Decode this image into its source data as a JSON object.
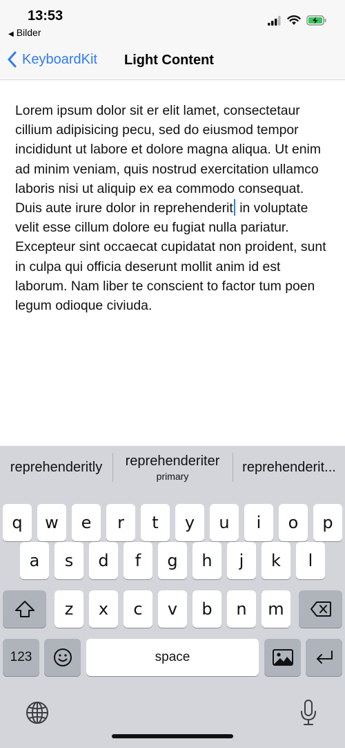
{
  "status_bar": {
    "time": "13:53",
    "back_app": "Bilder",
    "icons": [
      "cellular-signal-icon",
      "wifi-icon",
      "battery-charging-icon"
    ]
  },
  "nav": {
    "back_label": "KeyboardKit",
    "title": "Light Content"
  },
  "content": {
    "text_before_cursor": "Lorem ipsum dolor sit er elit lamet, consectetaur cillium adipisicing pecu, sed do eiusmod tempor incididunt ut labore et dolore magna aliqua. Ut enim ad minim veniam, quis nostrud exercitation ullamco laboris nisi ut aliquip ex ea commodo consequat. Duis aute irure dolor in reprehenderit",
    "text_after_cursor": " in voluptate velit esse cillum dolore eu fugiat nulla pariatur. Excepteur sint occaecat cupidatat non proident, sunt in culpa qui officia deserunt mollit anim id est laborum. Nam liber te conscient to factor tum poen legum odioque civiuda."
  },
  "keyboard": {
    "suggestions": [
      {
        "label": "reprehenderitly",
        "sub": ""
      },
      {
        "label": "reprehenderiter",
        "sub": "primary"
      },
      {
        "label": "reprehenderit..."
      }
    ],
    "row1": [
      "q",
      "w",
      "e",
      "r",
      "t",
      "y",
      "u",
      "i",
      "o",
      "p"
    ],
    "row2": [
      "a",
      "s",
      "d",
      "f",
      "g",
      "h",
      "j",
      "k",
      "l"
    ],
    "row3": [
      "z",
      "x",
      "c",
      "v",
      "b",
      "n",
      "m"
    ],
    "numbers_label": "123",
    "space_label": "space",
    "icons": {
      "shift": "shift-icon",
      "backspace": "backspace-icon",
      "emoji": "emoji-icon",
      "image": "image-icon",
      "return": "return-icon",
      "globe": "globe-icon",
      "mic": "microphone-icon"
    }
  }
}
